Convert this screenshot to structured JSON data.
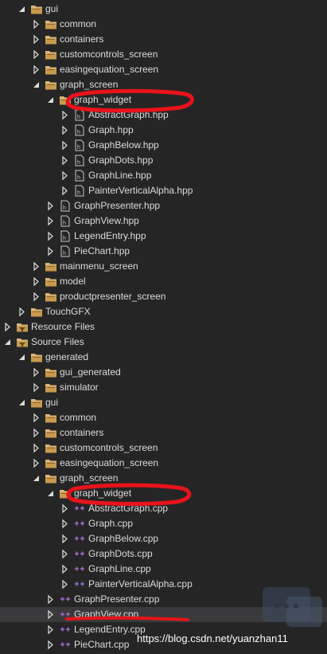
{
  "tree": {
    "rows": [
      {
        "indent": 2,
        "arrow": "open",
        "icon": "folder-icon",
        "label": "gui"
      },
      {
        "indent": 3,
        "arrow": "closed",
        "icon": "folder-icon",
        "label": "common"
      },
      {
        "indent": 3,
        "arrow": "closed",
        "icon": "folder-icon",
        "label": "containers"
      },
      {
        "indent": 3,
        "arrow": "closed",
        "icon": "folder-icon",
        "label": "customcontrols_screen"
      },
      {
        "indent": 3,
        "arrow": "closed",
        "icon": "folder-icon",
        "label": "easingequation_screen"
      },
      {
        "indent": 3,
        "arrow": "open",
        "icon": "folder-icon",
        "label": "graph_screen"
      },
      {
        "indent": 4,
        "arrow": "open",
        "icon": "folder-icon",
        "label": "graph_widget"
      },
      {
        "indent": 5,
        "arrow": "closed",
        "icon": "header-file-icon",
        "label": "AbstractGraph.hpp"
      },
      {
        "indent": 5,
        "arrow": "closed",
        "icon": "header-file-icon",
        "label": "Graph.hpp"
      },
      {
        "indent": 5,
        "arrow": "closed",
        "icon": "header-file-icon",
        "label": "GraphBelow.hpp"
      },
      {
        "indent": 5,
        "arrow": "closed",
        "icon": "header-file-icon",
        "label": "GraphDots.hpp"
      },
      {
        "indent": 5,
        "arrow": "closed",
        "icon": "header-file-icon",
        "label": "GraphLine.hpp"
      },
      {
        "indent": 5,
        "arrow": "closed",
        "icon": "header-file-icon",
        "label": "PainterVerticalAlpha.hpp"
      },
      {
        "indent": 4,
        "arrow": "closed",
        "icon": "header-file-icon",
        "label": "GraphPresenter.hpp"
      },
      {
        "indent": 4,
        "arrow": "closed",
        "icon": "header-file-icon",
        "label": "GraphView.hpp"
      },
      {
        "indent": 4,
        "arrow": "closed",
        "icon": "header-file-icon",
        "label": "LegendEntry.hpp"
      },
      {
        "indent": 4,
        "arrow": "closed",
        "icon": "header-file-icon",
        "label": "PieChart.hpp"
      },
      {
        "indent": 3,
        "arrow": "closed",
        "icon": "folder-icon",
        "label": "mainmenu_screen"
      },
      {
        "indent": 3,
        "arrow": "closed",
        "icon": "folder-icon",
        "label": "model"
      },
      {
        "indent": 3,
        "arrow": "closed",
        "icon": "folder-icon",
        "label": "productpresenter_screen"
      },
      {
        "indent": 2,
        "arrow": "closed",
        "icon": "folder-icon",
        "label": "TouchGFX"
      },
      {
        "indent": 1,
        "arrow": "closed",
        "icon": "filter-folder-icon",
        "label": "Resource Files"
      },
      {
        "indent": 1,
        "arrow": "open",
        "icon": "filter-folder-icon",
        "label": "Source Files"
      },
      {
        "indent": 2,
        "arrow": "open",
        "icon": "folder-icon",
        "label": "generated"
      },
      {
        "indent": 3,
        "arrow": "closed",
        "icon": "folder-icon",
        "label": "gui_generated"
      },
      {
        "indent": 3,
        "arrow": "closed",
        "icon": "folder-icon",
        "label": "simulator"
      },
      {
        "indent": 2,
        "arrow": "open",
        "icon": "folder-icon",
        "label": "gui"
      },
      {
        "indent": 3,
        "arrow": "closed",
        "icon": "folder-icon",
        "label": "common"
      },
      {
        "indent": 3,
        "arrow": "closed",
        "icon": "folder-icon",
        "label": "containers"
      },
      {
        "indent": 3,
        "arrow": "closed",
        "icon": "folder-icon",
        "label": "customcontrols_screen"
      },
      {
        "indent": 3,
        "arrow": "closed",
        "icon": "folder-icon",
        "label": "easingequation_screen"
      },
      {
        "indent": 3,
        "arrow": "open",
        "icon": "folder-icon",
        "label": "graph_screen"
      },
      {
        "indent": 4,
        "arrow": "open",
        "icon": "folder-icon",
        "label": "graph_widget"
      },
      {
        "indent": 5,
        "arrow": "closed",
        "icon": "cpp-file-icon",
        "label": "AbstractGraph.cpp"
      },
      {
        "indent": 5,
        "arrow": "closed",
        "icon": "cpp-file-icon",
        "label": "Graph.cpp"
      },
      {
        "indent": 5,
        "arrow": "closed",
        "icon": "cpp-file-icon",
        "label": "GraphBelow.cpp"
      },
      {
        "indent": 5,
        "arrow": "closed",
        "icon": "cpp-file-icon",
        "label": "GraphDots.cpp"
      },
      {
        "indent": 5,
        "arrow": "closed",
        "icon": "cpp-file-icon",
        "label": "GraphLine.cpp"
      },
      {
        "indent": 5,
        "arrow": "closed",
        "icon": "cpp-file-icon",
        "label": "PainterVerticalAlpha.cpp"
      },
      {
        "indent": 4,
        "arrow": "closed",
        "icon": "cpp-file-icon",
        "label": "GraphPresenter.cpp"
      },
      {
        "indent": 4,
        "arrow": "closed",
        "icon": "cpp-file-icon",
        "label": "GraphView.cpp",
        "selected": true
      },
      {
        "indent": 4,
        "arrow": "closed",
        "icon": "cpp-file-icon",
        "label": "LegendEntry.cpp"
      },
      {
        "indent": 4,
        "arrow": "closed",
        "icon": "cpp-file-icon",
        "label": "PieChart.cpp"
      }
    ]
  },
  "watermark": "https://blog.csdn.net/yuanzhan11",
  "colors": {
    "background": "#252526",
    "text": "#dcdcdc",
    "folder": "#dcb67a",
    "annotation": "#e8131b",
    "cpp_icon": "#9b6bc9",
    "header_icon": "#c8c8c8"
  }
}
